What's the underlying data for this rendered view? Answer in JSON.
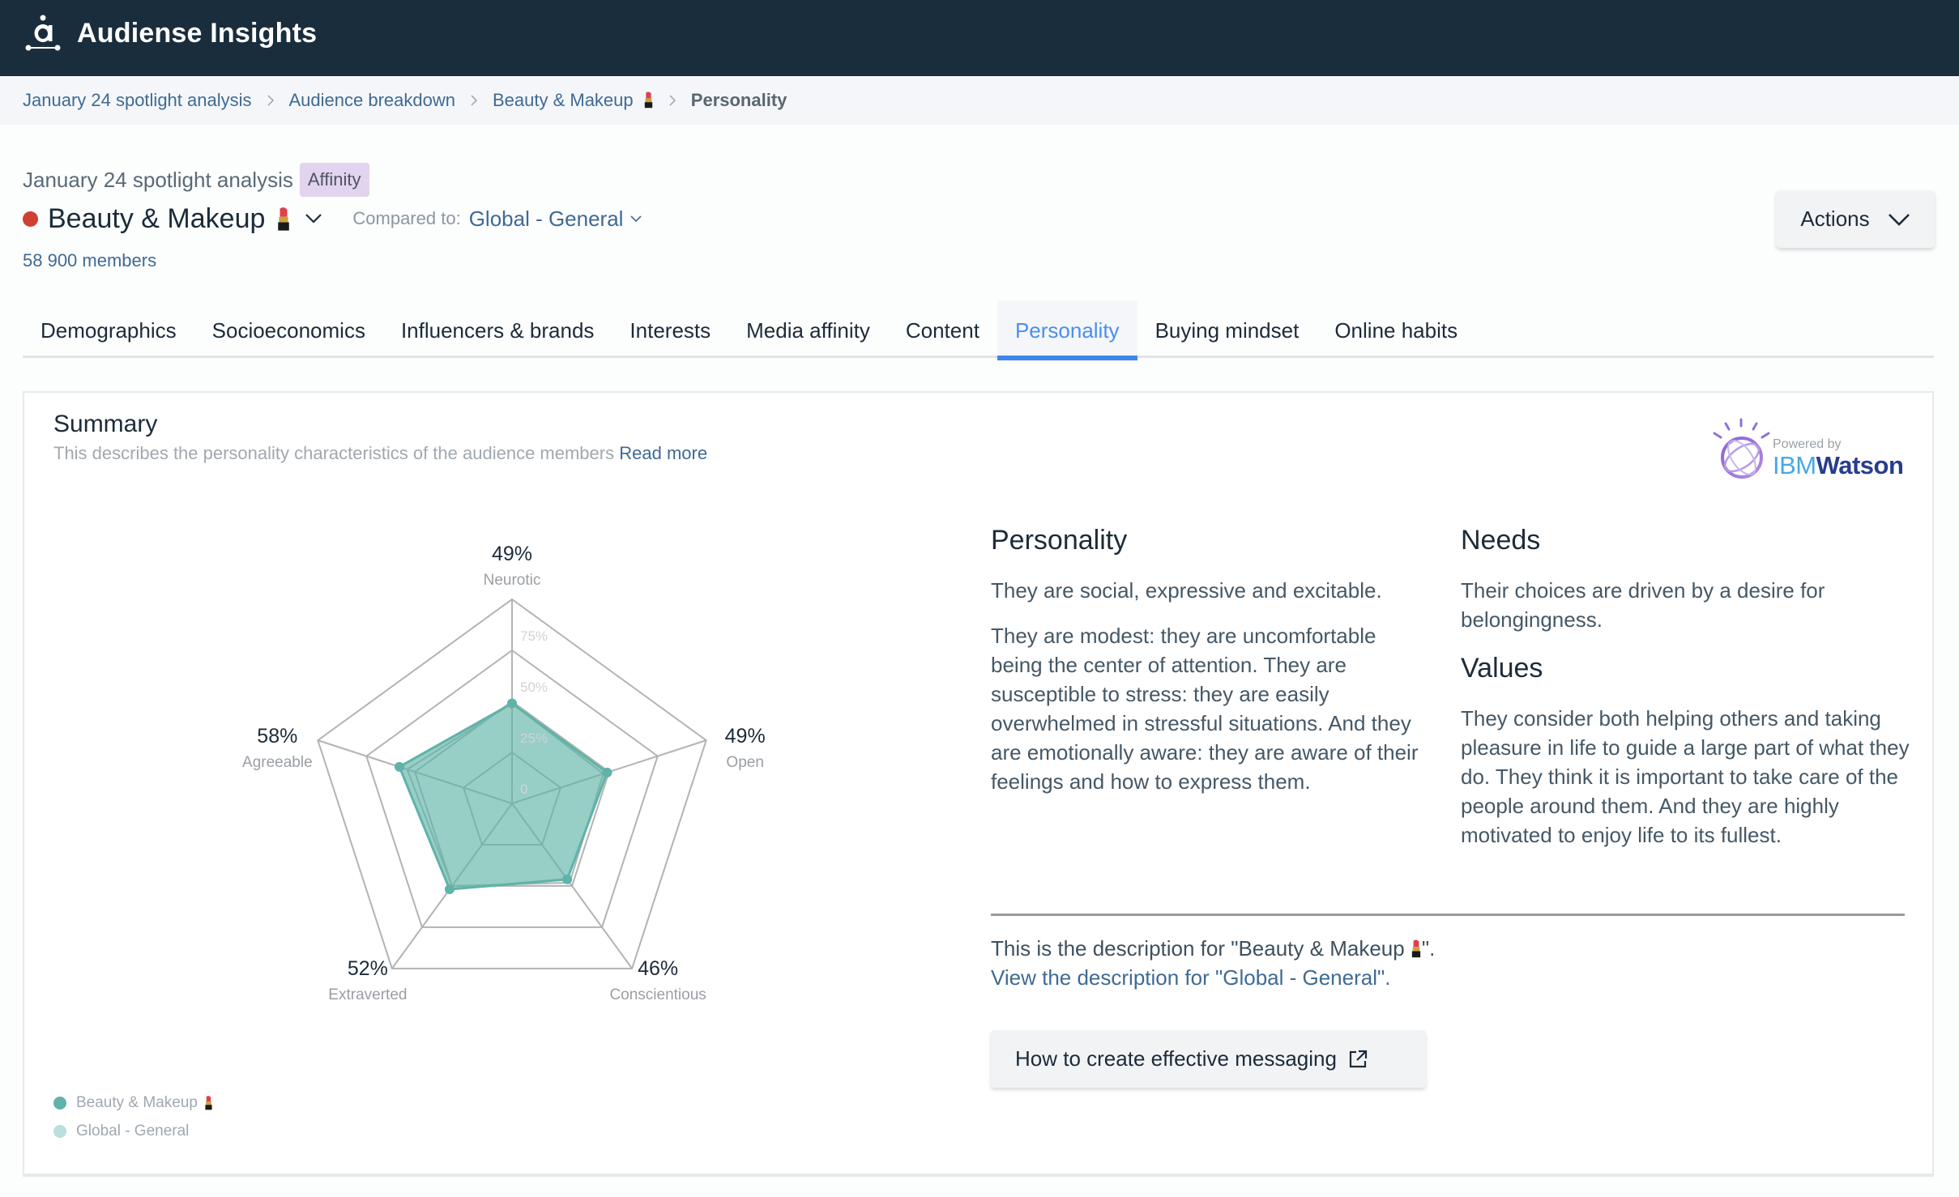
{
  "app": {
    "title": "Audiense Insights",
    "logo_icon": "audiense-logo-icon"
  },
  "breadcrumb": [
    {
      "label": "January 24 spotlight analysis"
    },
    {
      "label": "Audience breakdown"
    },
    {
      "label": "Beauty & Makeup",
      "emoji": "lipstick"
    },
    {
      "label": "Personality",
      "current": true
    }
  ],
  "header": {
    "analysis_name": "January 24 spotlight analysis",
    "badge": "Affinity",
    "segment_title": "Beauty & Makeup",
    "segment_emoji": "lipstick",
    "segment_color": "#cf4032",
    "compared_label": "Compared to:",
    "compared_value": "Global - General",
    "members": "58 900 members",
    "actions_label": "Actions"
  },
  "tabs": [
    {
      "label": "Demographics"
    },
    {
      "label": "Socioeconomics"
    },
    {
      "label": "Influencers & brands"
    },
    {
      "label": "Interests"
    },
    {
      "label": "Media affinity"
    },
    {
      "label": "Content"
    },
    {
      "label": "Personality",
      "active": true
    },
    {
      "label": "Buying mindset"
    },
    {
      "label": "Online habits"
    }
  ],
  "summary": {
    "title": "Summary",
    "description": "This describes the personality characteristics of the audience members",
    "read_more": "Read more",
    "watson_powered": "Powered by",
    "watson_ibm": "IBM",
    "watson_name": "Watson"
  },
  "chart_data": {
    "type": "radar",
    "axes": [
      "Neurotic",
      "Open",
      "Conscientious",
      "Extraverted",
      "Agreeable"
    ],
    "value_labels": [
      "49%",
      "49%",
      "46%",
      "52%",
      "58%"
    ],
    "series": [
      {
        "name": "Beauty & Makeup",
        "emoji": "lipstick",
        "color": "#5fb3a8",
        "values": [
          49,
          49,
          46,
          52,
          58
        ]
      },
      {
        "name": "Global - General",
        "color": "#b9e0dc",
        "values": [
          49,
          47,
          48,
          50,
          54
        ]
      }
    ],
    "ring_values": [
      25,
      50,
      75,
      100
    ],
    "ring_labels": [
      "0",
      "25%",
      "50%",
      "75%"
    ],
    "range": [
      0,
      100
    ],
    "legend_position": "bottom-left"
  },
  "personality": {
    "heading": "Personality",
    "paragraphs": [
      "They are social, expressive and excitable.",
      "They are modest: they are uncomfortable being the center of attention. They are susceptible to stress: they are easily overwhelmed in stressful situations. And they are emotionally aware: they are aware of their feelings and how to express them."
    ]
  },
  "needs": {
    "heading": "Needs",
    "body": "Their choices are driven by a desire for belongingness."
  },
  "values": {
    "heading": "Values",
    "body": "They consider both helping others and taking pleasure in life to guide a large part of what they do. They think it is important to take care of the people around them. And they are highly motivated to enjoy life to its fullest."
  },
  "description": {
    "current_prefix": "This is the description for \"Beauty & Makeup ",
    "current_suffix": "\".",
    "view_other": "View the description for \"Global - General\"."
  },
  "messaging_button": {
    "label": "How to create effective messaging",
    "icon": "external-link-icon"
  }
}
